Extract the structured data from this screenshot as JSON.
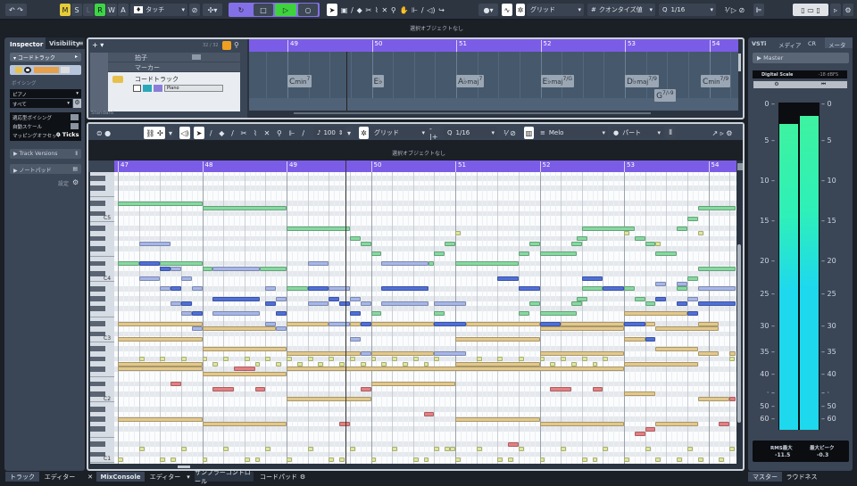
{
  "toolbar": {
    "mode_buttons": [
      "M",
      "S",
      "L",
      "R",
      "W",
      "A"
    ],
    "automation_mode": "タッチ",
    "grid_type": "グリッド",
    "quantize_type": "クオンタイズ値",
    "quantize_value": "1/16"
  },
  "status": {
    "top": "選択オブジェクトなし",
    "editor": "選択オブジェクトなし"
  },
  "inspector": {
    "tabs": [
      "Inspector",
      "Visibility"
    ],
    "track_name": "コードトラック",
    "voicing_label": "ボイシング",
    "voicing_value": "ピアノ",
    "voicing_sub": "すべて",
    "adaptive_voicing": "適応型ボイシング",
    "auto_scale": "自動スケール",
    "mapping_offset_label": "マッピングオフセット",
    "mapping_offset_value": "0 Ticks",
    "track_versions": "Track Versions",
    "notepad": "ノートパッド",
    "settings": "設定"
  },
  "project": {
    "track_count": "32 / 32",
    "tracks": [
      {
        "name": "拍子"
      },
      {
        "name": "マーカー"
      },
      {
        "name": "コードトラック",
        "instrument": "Piano"
      }
    ],
    "preset": "Standard",
    "ruler_bars": [
      "49",
      "50",
      "51",
      "52",
      "53",
      "54"
    ],
    "chords": [
      {
        "root": "C",
        "qual": "min",
        "ext": "7",
        "bar": 49.0,
        "row": 0
      },
      {
        "root": "E♭",
        "qual": "",
        "ext": "",
        "bar": 50.0,
        "row": 0
      },
      {
        "root": "A♭",
        "qual": "maj",
        "ext": "7",
        "bar": 51.0,
        "row": 0
      },
      {
        "root": "E♭",
        "qual": "maj",
        "ext": "7/G",
        "bar": 52.0,
        "row": 0
      },
      {
        "root": "D♭",
        "qual": "maj",
        "ext": "7/9",
        "bar": 53.0,
        "row": 0
      },
      {
        "root": "G",
        "qual": "",
        "ext": "7/♭9",
        "bar": 53.35,
        "row": 1
      },
      {
        "root": "C",
        "qual": "min",
        "ext": "7/9",
        "bar": 53.9,
        "row": 0
      }
    ],
    "playhead_bar": 49.7
  },
  "editor": {
    "velocity": "100",
    "grid_type": "グリッド",
    "quantize_value": "1/16",
    "chord_source": "Melo",
    "part": "パート",
    "ruler_bars": [
      "47",
      "48",
      "49",
      "50",
      "51",
      "52",
      "53",
      "54"
    ],
    "key_labels": [
      "C5",
      "C4",
      "C3",
      "C2",
      "C1"
    ],
    "colors": {
      "g": "#86d9a0",
      "l": "#a6b6e8",
      "d": "#4f6fd8",
      "t": "#e2c88c",
      "r": "#e47f82",
      "y": "#dfe79c"
    },
    "notes": [
      [
        0,
        4,
        87,
        "g"
      ],
      [
        4,
        4,
        86,
        "g"
      ],
      [
        8,
        3,
        82,
        "g"
      ],
      [
        11,
        0.5,
        80,
        "g"
      ],
      [
        11.5,
        0.5,
        79,
        "g"
      ],
      [
        12,
        0.5,
        77,
        "g"
      ],
      [
        1,
        1.5,
        79,
        "l"
      ],
      [
        0,
        1,
        75,
        "g"
      ],
      [
        1,
        1,
        75,
        "d"
      ],
      [
        2,
        2,
        75,
        "g"
      ],
      [
        2,
        0.5,
        74,
        "d"
      ],
      [
        2.5,
        0.5,
        74,
        "l"
      ],
      [
        4,
        0.5,
        74,
        "g"
      ],
      [
        4.5,
        2.25,
        74,
        "l"
      ],
      [
        6.75,
        1.25,
        74,
        "g"
      ],
      [
        9,
        1,
        75,
        "l"
      ],
      [
        12.5,
        2.25,
        75,
        "l"
      ],
      [
        14.75,
        0.25,
        75,
        "g"
      ],
      [
        1,
        1,
        72,
        "l"
      ],
      [
        3,
        0.5,
        72,
        "l"
      ],
      [
        2,
        0.5,
        70,
        "l"
      ],
      [
        2.5,
        0.5,
        70,
        "d"
      ],
      [
        3.5,
        0.5,
        70,
        "l"
      ],
      [
        7,
        0.5,
        70,
        "l"
      ],
      [
        8,
        1,
        70,
        "g"
      ],
      [
        9,
        1,
        70,
        "d"
      ],
      [
        10,
        1,
        70,
        "l"
      ],
      [
        12.5,
        2.25,
        70,
        "d"
      ],
      [
        4.5,
        2.25,
        68,
        "d"
      ],
      [
        7.5,
        0.5,
        68,
        "l"
      ],
      [
        10,
        0.5,
        68,
        "d"
      ],
      [
        11,
        0.5,
        68,
        "l"
      ],
      [
        2.5,
        0.5,
        67,
        "l"
      ],
      [
        3,
        0.5,
        67,
        "d"
      ],
      [
        7,
        0.5,
        67,
        "d"
      ],
      [
        9,
        1,
        67,
        "l"
      ],
      [
        10.5,
        0.5,
        67,
        "d"
      ],
      [
        11.5,
        0.5,
        67,
        "l"
      ],
      [
        12.5,
        2.25,
        67,
        "l"
      ],
      [
        15,
        1.5,
        67,
        "l"
      ],
      [
        3,
        0.5,
        65,
        "l"
      ],
      [
        3.5,
        0.5,
        65,
        "d"
      ],
      [
        4.5,
        2.25,
        65,
        "l"
      ],
      [
        7.5,
        0.5,
        65,
        "d"
      ],
      [
        11,
        0.5,
        65,
        "d"
      ],
      [
        12,
        0.5,
        65,
        "g"
      ],
      [
        15,
        0.5,
        77,
        "g"
      ],
      [
        15.5,
        0.5,
        79,
        "g"
      ],
      [
        16,
        0.25,
        81,
        "y"
      ],
      [
        16,
        3,
        75,
        "g"
      ],
      [
        19,
        0.5,
        77,
        "g"
      ],
      [
        19.5,
        0.5,
        79,
        "g"
      ],
      [
        20,
        1.75,
        77,
        "g"
      ],
      [
        21.5,
        0.5,
        79,
        "g"
      ],
      [
        21.75,
        0.5,
        80,
        "g"
      ],
      [
        22,
        2.5,
        82,
        "g"
      ],
      [
        24,
        0.25,
        81,
        "y"
      ],
      [
        24.5,
        0.5,
        80,
        "g"
      ],
      [
        25,
        0.5,
        79,
        "g"
      ],
      [
        25.5,
        0.25,
        79,
        "y"
      ],
      [
        25.5,
        1,
        77,
        "g"
      ],
      [
        26.5,
        0.5,
        82,
        "g"
      ],
      [
        27,
        0.5,
        84,
        "g"
      ],
      [
        27.5,
        1.8,
        86,
        "g"
      ],
      [
        27.5,
        0.25,
        81,
        "y"
      ],
      [
        18,
        1,
        72,
        "d"
      ],
      [
        22,
        1,
        72,
        "d"
      ],
      [
        27,
        0.5,
        72,
        "g"
      ],
      [
        27.5,
        1.8,
        74,
        "g"
      ],
      [
        19,
        1,
        70,
        "d"
      ],
      [
        22,
        1,
        70,
        "g"
      ],
      [
        23,
        1,
        70,
        "d"
      ],
      [
        24,
        0.5,
        70,
        "g"
      ],
      [
        25.5,
        0.5,
        71,
        "l"
      ],
      [
        26.5,
        0.5,
        71,
        "l"
      ],
      [
        26.5,
        0.5,
        70,
        "g"
      ],
      [
        27.5,
        1.8,
        70,
        "l"
      ],
      [
        21.75,
        0.5,
        68,
        "g"
      ],
      [
        24.5,
        0.5,
        68,
        "g"
      ],
      [
        25.5,
        0.5,
        68,
        "d"
      ],
      [
        27,
        0.5,
        68,
        "l"
      ],
      [
        19.5,
        0.5,
        67,
        "g"
      ],
      [
        21.5,
        0.5,
        67,
        "g"
      ],
      [
        25,
        0.5,
        67,
        "g"
      ],
      [
        26.5,
        0.5,
        67,
        "d"
      ],
      [
        27.5,
        1.8,
        67,
        "d"
      ],
      [
        15,
        0.5,
        65,
        "g"
      ],
      [
        19,
        0.5,
        65,
        "g"
      ],
      [
        20,
        1.75,
        65,
        "g"
      ],
      [
        24,
        3,
        65,
        "t"
      ],
      [
        27,
        0.5,
        65,
        "d"
      ],
      [
        0,
        4,
        63,
        "t"
      ],
      [
        3.5,
        0.5,
        62,
        "l"
      ],
      [
        4,
        3.5,
        62,
        "t"
      ],
      [
        7,
        0.5,
        63,
        "l"
      ],
      [
        7.5,
        0.5,
        62,
        "l"
      ],
      [
        8,
        2,
        63,
        "t"
      ],
      [
        10,
        1,
        63,
        "l"
      ],
      [
        11,
        0.5,
        63,
        "t"
      ],
      [
        11.5,
        0.5,
        63,
        "d"
      ],
      [
        12,
        3,
        63,
        "t"
      ],
      [
        15,
        1.5,
        63,
        "d"
      ],
      [
        16.5,
        3.5,
        63,
        "t"
      ],
      [
        20,
        1,
        63,
        "d"
      ],
      [
        21,
        3,
        63,
        "t"
      ],
      [
        24,
        1,
        63,
        "d"
      ],
      [
        25,
        0.5,
        63,
        "t"
      ],
      [
        27.5,
        1,
        63,
        "t"
      ],
      [
        20,
        4,
        62,
        "t"
      ],
      [
        25.5,
        3,
        62,
        "t"
      ],
      [
        0,
        4,
        60,
        "t"
      ],
      [
        11,
        0.5,
        60,
        "l"
      ],
      [
        16,
        4,
        60,
        "t"
      ],
      [
        24,
        1,
        60,
        "t"
      ],
      [
        25,
        0.5,
        60,
        "d"
      ],
      [
        4,
        4,
        58,
        "t"
      ],
      [
        25.5,
        2,
        58,
        "t"
      ],
      [
        8,
        3.5,
        57,
        "t"
      ],
      [
        11.5,
        0.5,
        57,
        "l"
      ],
      [
        12,
        3,
        57,
        "t"
      ],
      [
        15,
        1.5,
        57,
        "l"
      ],
      [
        20,
        4,
        57,
        "t"
      ],
      [
        27.5,
        1,
        57,
        "t"
      ],
      [
        29,
        0.3,
        57,
        "t"
      ],
      [
        0,
        4,
        55,
        "t"
      ],
      [
        16,
        4,
        55,
        "t"
      ],
      [
        24,
        3.5,
        55,
        "t"
      ],
      [
        0,
        4,
        54,
        "t"
      ],
      [
        8,
        16,
        54,
        "t"
      ],
      [
        5.5,
        1,
        54,
        "r"
      ],
      [
        4,
        4,
        53,
        "t"
      ],
      [
        2.5,
        0.5,
        51,
        "r"
      ],
      [
        4.5,
        1,
        50,
        "r"
      ],
      [
        6.5,
        0.5,
        50,
        "r"
      ],
      [
        11.5,
        0.5,
        50,
        "r"
      ],
      [
        12,
        4,
        51,
        "t"
      ],
      [
        20.5,
        1,
        50,
        "r"
      ],
      [
        22.5,
        0.5,
        50,
        "r"
      ],
      [
        24,
        1.5,
        49,
        "t"
      ],
      [
        8,
        4,
        48,
        "t"
      ],
      [
        27.5,
        1.5,
        48,
        "t"
      ],
      [
        29,
        0.3,
        48,
        "r"
      ],
      [
        14.5,
        0.5,
        45,
        "r"
      ],
      [
        0,
        4,
        44,
        "t"
      ],
      [
        16,
        4,
        44,
        "t"
      ],
      [
        4,
        4,
        43,
        "t"
      ],
      [
        20,
        4,
        43,
        "t"
      ],
      [
        25.5,
        2,
        43,
        "t"
      ],
      [
        28.5,
        0.5,
        43,
        "r"
      ],
      [
        10.5,
        0.5,
        43,
        "r"
      ],
      [
        25,
        0.5,
        42,
        "r"
      ],
      [
        24.5,
        0.5,
        41,
        "r"
      ],
      [
        18.5,
        0.5,
        39,
        "r"
      ],
      [
        1,
        0.25,
        56,
        "y"
      ],
      [
        2,
        0.25,
        56,
        "y"
      ],
      [
        3,
        0.25,
        56,
        "y"
      ],
      [
        4,
        0.25,
        56,
        "y"
      ],
      [
        5,
        0.25,
        56,
        "y"
      ],
      [
        6,
        0.25,
        56,
        "y"
      ],
      [
        7,
        0.25,
        56,
        "y"
      ],
      [
        8,
        0.25,
        56,
        "y"
      ],
      [
        9,
        0.25,
        56,
        "y"
      ],
      [
        10,
        0.25,
        56,
        "y"
      ],
      [
        11,
        0.25,
        56,
        "y"
      ],
      [
        12,
        0.25,
        56,
        "y"
      ],
      [
        13,
        0.25,
        56,
        "y"
      ],
      [
        14,
        0.25,
        56,
        "y"
      ],
      [
        15,
        0.25,
        56,
        "y"
      ],
      [
        17,
        0.25,
        56,
        "y"
      ],
      [
        18,
        0.25,
        56,
        "y"
      ],
      [
        19,
        0.25,
        56,
        "y"
      ],
      [
        20,
        0.25,
        56,
        "y"
      ],
      [
        21,
        0.25,
        56,
        "y"
      ],
      [
        22,
        0.25,
        56,
        "y"
      ],
      [
        23,
        0.25,
        56,
        "y"
      ],
      [
        29,
        0.25,
        56,
        "y"
      ],
      [
        4.5,
        0.25,
        55,
        "y"
      ],
      [
        6.5,
        0.25,
        55,
        "y"
      ],
      [
        7.5,
        0.25,
        55,
        "y"
      ],
      [
        8.5,
        0.25,
        55,
        "y"
      ],
      [
        9.5,
        0.25,
        55,
        "y"
      ],
      [
        10.5,
        0.25,
        55,
        "y"
      ],
      [
        11.5,
        0.25,
        55,
        "y"
      ],
      [
        12.5,
        0.25,
        55,
        "y"
      ],
      [
        13.5,
        0.25,
        55,
        "y"
      ],
      [
        14.5,
        0.25,
        55,
        "y"
      ],
      [
        20.5,
        0.25,
        55,
        "y"
      ],
      [
        21.5,
        0.25,
        55,
        "y"
      ],
      [
        22.5,
        0.25,
        55,
        "y"
      ],
      [
        1,
        0.25,
        38,
        "y"
      ],
      [
        3,
        0.25,
        38,
        "y"
      ],
      [
        5,
        0.25,
        38,
        "y"
      ],
      [
        7,
        0.25,
        38,
        "y"
      ],
      [
        9,
        0.25,
        38,
        "y"
      ],
      [
        11,
        0.25,
        38,
        "y"
      ],
      [
        13,
        0.25,
        38,
        "y"
      ],
      [
        15,
        0.25,
        38,
        "y"
      ],
      [
        15.5,
        0.25,
        38,
        "y"
      ],
      [
        15.75,
        0.25,
        38,
        "y"
      ],
      [
        17,
        0.25,
        38,
        "y"
      ],
      [
        19,
        0.25,
        38,
        "y"
      ],
      [
        21,
        0.25,
        38,
        "y"
      ],
      [
        23,
        0.25,
        38,
        "y"
      ],
      [
        25,
        0.25,
        38,
        "y"
      ],
      [
        27,
        0.25,
        38,
        "y"
      ],
      [
        29,
        0.25,
        38,
        "y"
      ],
      [
        0,
        0.25,
        36,
        "y"
      ],
      [
        2,
        0.25,
        36,
        "y"
      ],
      [
        2.5,
        0.25,
        36,
        "y"
      ],
      [
        4,
        0.25,
        36,
        "y"
      ],
      [
        6,
        0.25,
        36,
        "y"
      ],
      [
        6.5,
        0.25,
        36,
        "y"
      ],
      [
        8,
        0.25,
        36,
        "y"
      ],
      [
        10,
        0.25,
        36,
        "y"
      ],
      [
        10.5,
        0.25,
        36,
        "y"
      ],
      [
        12,
        0.25,
        36,
        "y"
      ],
      [
        14,
        0.25,
        36,
        "y"
      ],
      [
        14.5,
        0.25,
        36,
        "y"
      ],
      [
        16,
        0.25,
        36,
        "y"
      ],
      [
        18,
        0.25,
        36,
        "y"
      ],
      [
        18.5,
        0.25,
        36,
        "y"
      ],
      [
        20,
        0.25,
        36,
        "y"
      ],
      [
        22,
        0.25,
        36,
        "y"
      ],
      [
        22.5,
        0.25,
        36,
        "y"
      ],
      [
        24,
        0.25,
        36,
        "y"
      ],
      [
        25.5,
        0.25,
        36,
        "y"
      ],
      [
        26.5,
        0.25,
        36,
        "y"
      ],
      [
        27.5,
        0.25,
        36,
        "y"
      ],
      [
        28.5,
        0.25,
        36,
        "y"
      ]
    ]
  },
  "rightpanel": {
    "tabs": [
      "VSTi",
      "メディア",
      "CR",
      "メーター"
    ],
    "master": "Master",
    "scale_name": "Digital Scale",
    "scale_ref": "-18 dBFS",
    "scale_ticks": [
      "0",
      "5",
      "10",
      "15",
      "20",
      "25",
      "30",
      "35",
      "40",
      "·",
      "50",
      "60"
    ],
    "left_level_db": -1.5,
    "right_level_db": -0.8,
    "rms_label": "RMS最大",
    "rms_value": "-11.5",
    "peak_label": "最大ピーク",
    "peak_value": "-0.3",
    "bottom_tabs": [
      "マスター",
      "ラウドネス"
    ]
  },
  "bottom_tabs": [
    "トラック",
    "エディター",
    "MixConsole",
    "エディター",
    "サンプラーコントロール",
    "コードパッド"
  ]
}
